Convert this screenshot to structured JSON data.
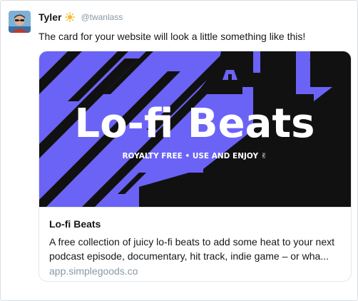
{
  "user": {
    "name": "Tyler",
    "handle": "@twanlass",
    "badge_icon": "sun-icon",
    "avatar_icon": "avatar-photo"
  },
  "tweet": {
    "text": "The card for your website will look a little something like this!"
  },
  "card": {
    "image": {
      "headline": "Lo-fi Beats",
      "tagline": "ROYALTY FREE • USE AND ENJOY ✌",
      "bg_color": "#6b63f6",
      "dark_color": "#111111"
    },
    "title": "Lo-fi Beats",
    "description": "A free collection of juicy lo-fi beats to add some heat to your next podcast episode, documentary, hit track, indie game – or wha...",
    "domain": "app.simplegoods.co"
  }
}
